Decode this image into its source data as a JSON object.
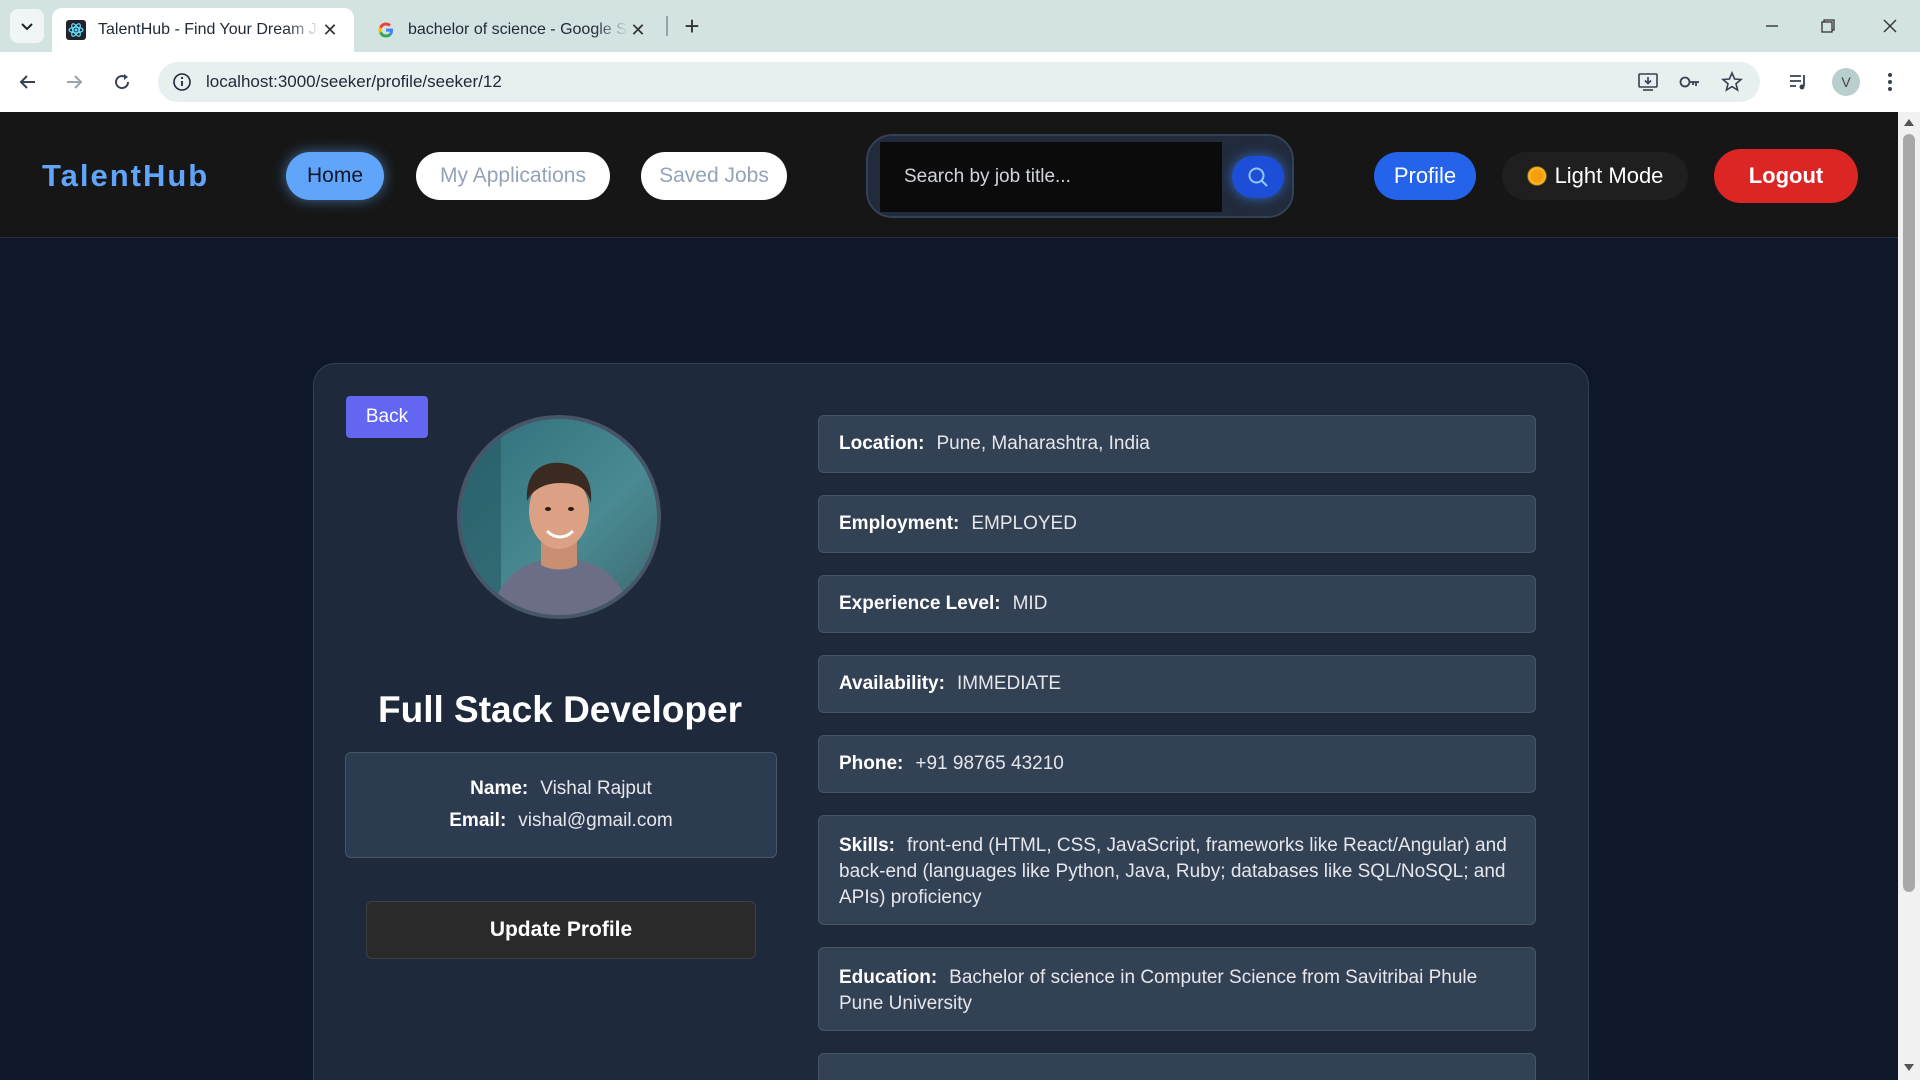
{
  "browser": {
    "tabs": [
      {
        "title": "TalentHub - Find Your Dream Jobs",
        "active": true,
        "icon": "react-icon"
      },
      {
        "title": "bachelor of science - Google Search",
        "active": false,
        "icon": "google-icon"
      }
    ],
    "url": "localhost:3000/seeker/profile/seeker/12",
    "profile_initial": "V"
  },
  "navbar": {
    "brand": "TalentHub",
    "home_label": "Home",
    "applications_label": "My Applications",
    "saved_label": "Saved Jobs",
    "search_placeholder": "Search by job title...",
    "profile_label": "Profile",
    "mode_label": "Light Mode",
    "logout_label": "Logout"
  },
  "profile": {
    "back_label": "Back",
    "headline": "Full Stack Developer",
    "name_label": "Name:",
    "name": "Vishal Rajput",
    "email_label": "Email:",
    "email": "vishal@gmail.com",
    "update_label": "Update Profile",
    "details": [
      {
        "label": "Location:",
        "value": "Pune, Maharashtra, India"
      },
      {
        "label": "Employment:",
        "value": "EMPLOYED"
      },
      {
        "label": "Experience Level:",
        "value": "MID"
      },
      {
        "label": "Availability:",
        "value": "IMMEDIATE"
      },
      {
        "label": "Phone:",
        "value": "+91 98765 43210"
      },
      {
        "label": "Skills:",
        "value": "front-end (HTML, CSS, JavaScript, frameworks like React/Angular) and back-end (languages like Python, Java, Ruby; databases like SQL/NoSQL; and APIs) proficiency"
      },
      {
        "label": "Education:",
        "value": "Bachelor of science in Computer Science from Savitribai Phule Pune University"
      }
    ]
  },
  "colors": {
    "accent": "#60a5fa",
    "primary": "#2563eb",
    "danger": "#dc2626",
    "back": "#6366f1",
    "page_bg": "#0f172a",
    "card_bg": "#1e293b"
  }
}
